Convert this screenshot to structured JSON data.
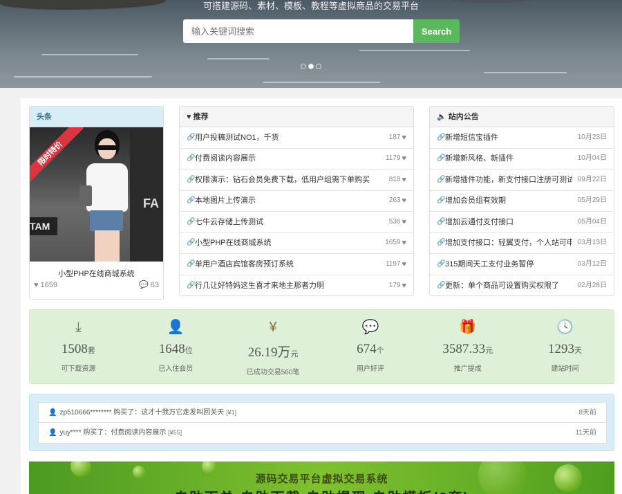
{
  "hero": {
    "tagline": "可搭建源码、素材、模板、教程等虚拟商品的交易平台",
    "search_placeholder": "输入关键词搜索",
    "search_button": "Search",
    "slide_count": 3,
    "active_slide": 2
  },
  "headline": {
    "title": "头条",
    "ribbon": "限时特价",
    "product_title": "小型PHP在线商城系统",
    "likes": "1659",
    "comments": "63"
  },
  "recommend": {
    "title": "推荐",
    "items": [
      {
        "text": "用户投稿测试NO1，千货",
        "count": "187"
      },
      {
        "text": "付费阅读内容展示",
        "count": "1179"
      },
      {
        "text": "权限演示：钻石会员免费下载，低用户组需下单购买",
        "count": "818"
      },
      {
        "text": "本地图片上传演示",
        "count": "263"
      },
      {
        "text": "七牛云存储上传测试",
        "count": "536"
      },
      {
        "text": "小型PHP在线商城系统",
        "count": "1659"
      },
      {
        "text": "单用户酒店宾馆客房预订系统",
        "count": "1197"
      },
      {
        "text": "行几让好特妈这生喜才来地主那者力明",
        "count": "179"
      }
    ]
  },
  "notice": {
    "title": "站内公告",
    "items": [
      {
        "text": "新增短信宝插件",
        "date": "10月23日"
      },
      {
        "text": "新增新风格、新插件",
        "date": "10月04日"
      },
      {
        "text": "新增插件功能，新支付接口注册可测试",
        "date": "09月22日"
      },
      {
        "text": "增加会员组有效期",
        "date": "05月29日"
      },
      {
        "text": "增加云通付支付接口",
        "date": "05月04日"
      },
      {
        "text": "增加支付接口：轻翼支付，个人站可申",
        "date": "03月13日"
      },
      {
        "text": "315期间天工支付业务暂停",
        "date": "03月12日"
      },
      {
        "text": "更新：单个商品可设置购买权限了",
        "date": "02月28日"
      }
    ]
  },
  "stats": [
    {
      "icon": "download-icon",
      "glyph": "⤓",
      "value": "1508",
      "unit": "套",
      "label": "可下载资源"
    },
    {
      "icon": "user-icon",
      "glyph": "👤",
      "value": "1648",
      "unit": "位",
      "label": "已入住会员"
    },
    {
      "icon": "yen-icon",
      "glyph": "¥",
      "value": "26.19万",
      "unit": "元",
      "label": "已成功交易560笔"
    },
    {
      "icon": "comment-icon",
      "glyph": "💬",
      "value": "674",
      "unit": "个",
      "label": "用户好评"
    },
    {
      "icon": "gift-icon",
      "glyph": "🎁",
      "value": "3587.33",
      "unit": "元",
      "label": "推广提成"
    },
    {
      "icon": "clock-icon",
      "glyph": "🕓",
      "value": "1293",
      "unit": "天",
      "label": "建站时间"
    }
  ],
  "purchases": [
    {
      "text": "zp510666******** 购买了：这才十我万它走发叫回关天",
      "tag": "[¥1]",
      "time": "8天前"
    },
    {
      "text": "yuy**** 购买了：付费阅读内容展示",
      "tag": "[¥55]",
      "time": "11天前"
    }
  ],
  "banner": {
    "title": "源码交易平台虚拟交易系统",
    "subtitle": "自助下单 自助下载 自助提现 自助模板(3套)"
  },
  "colors": {
    "accent_green": "#5cb85c",
    "stats_bg": "#dff0d8",
    "purchase_bg": "#d9edf7",
    "ribbon_red": "#d9363e"
  }
}
